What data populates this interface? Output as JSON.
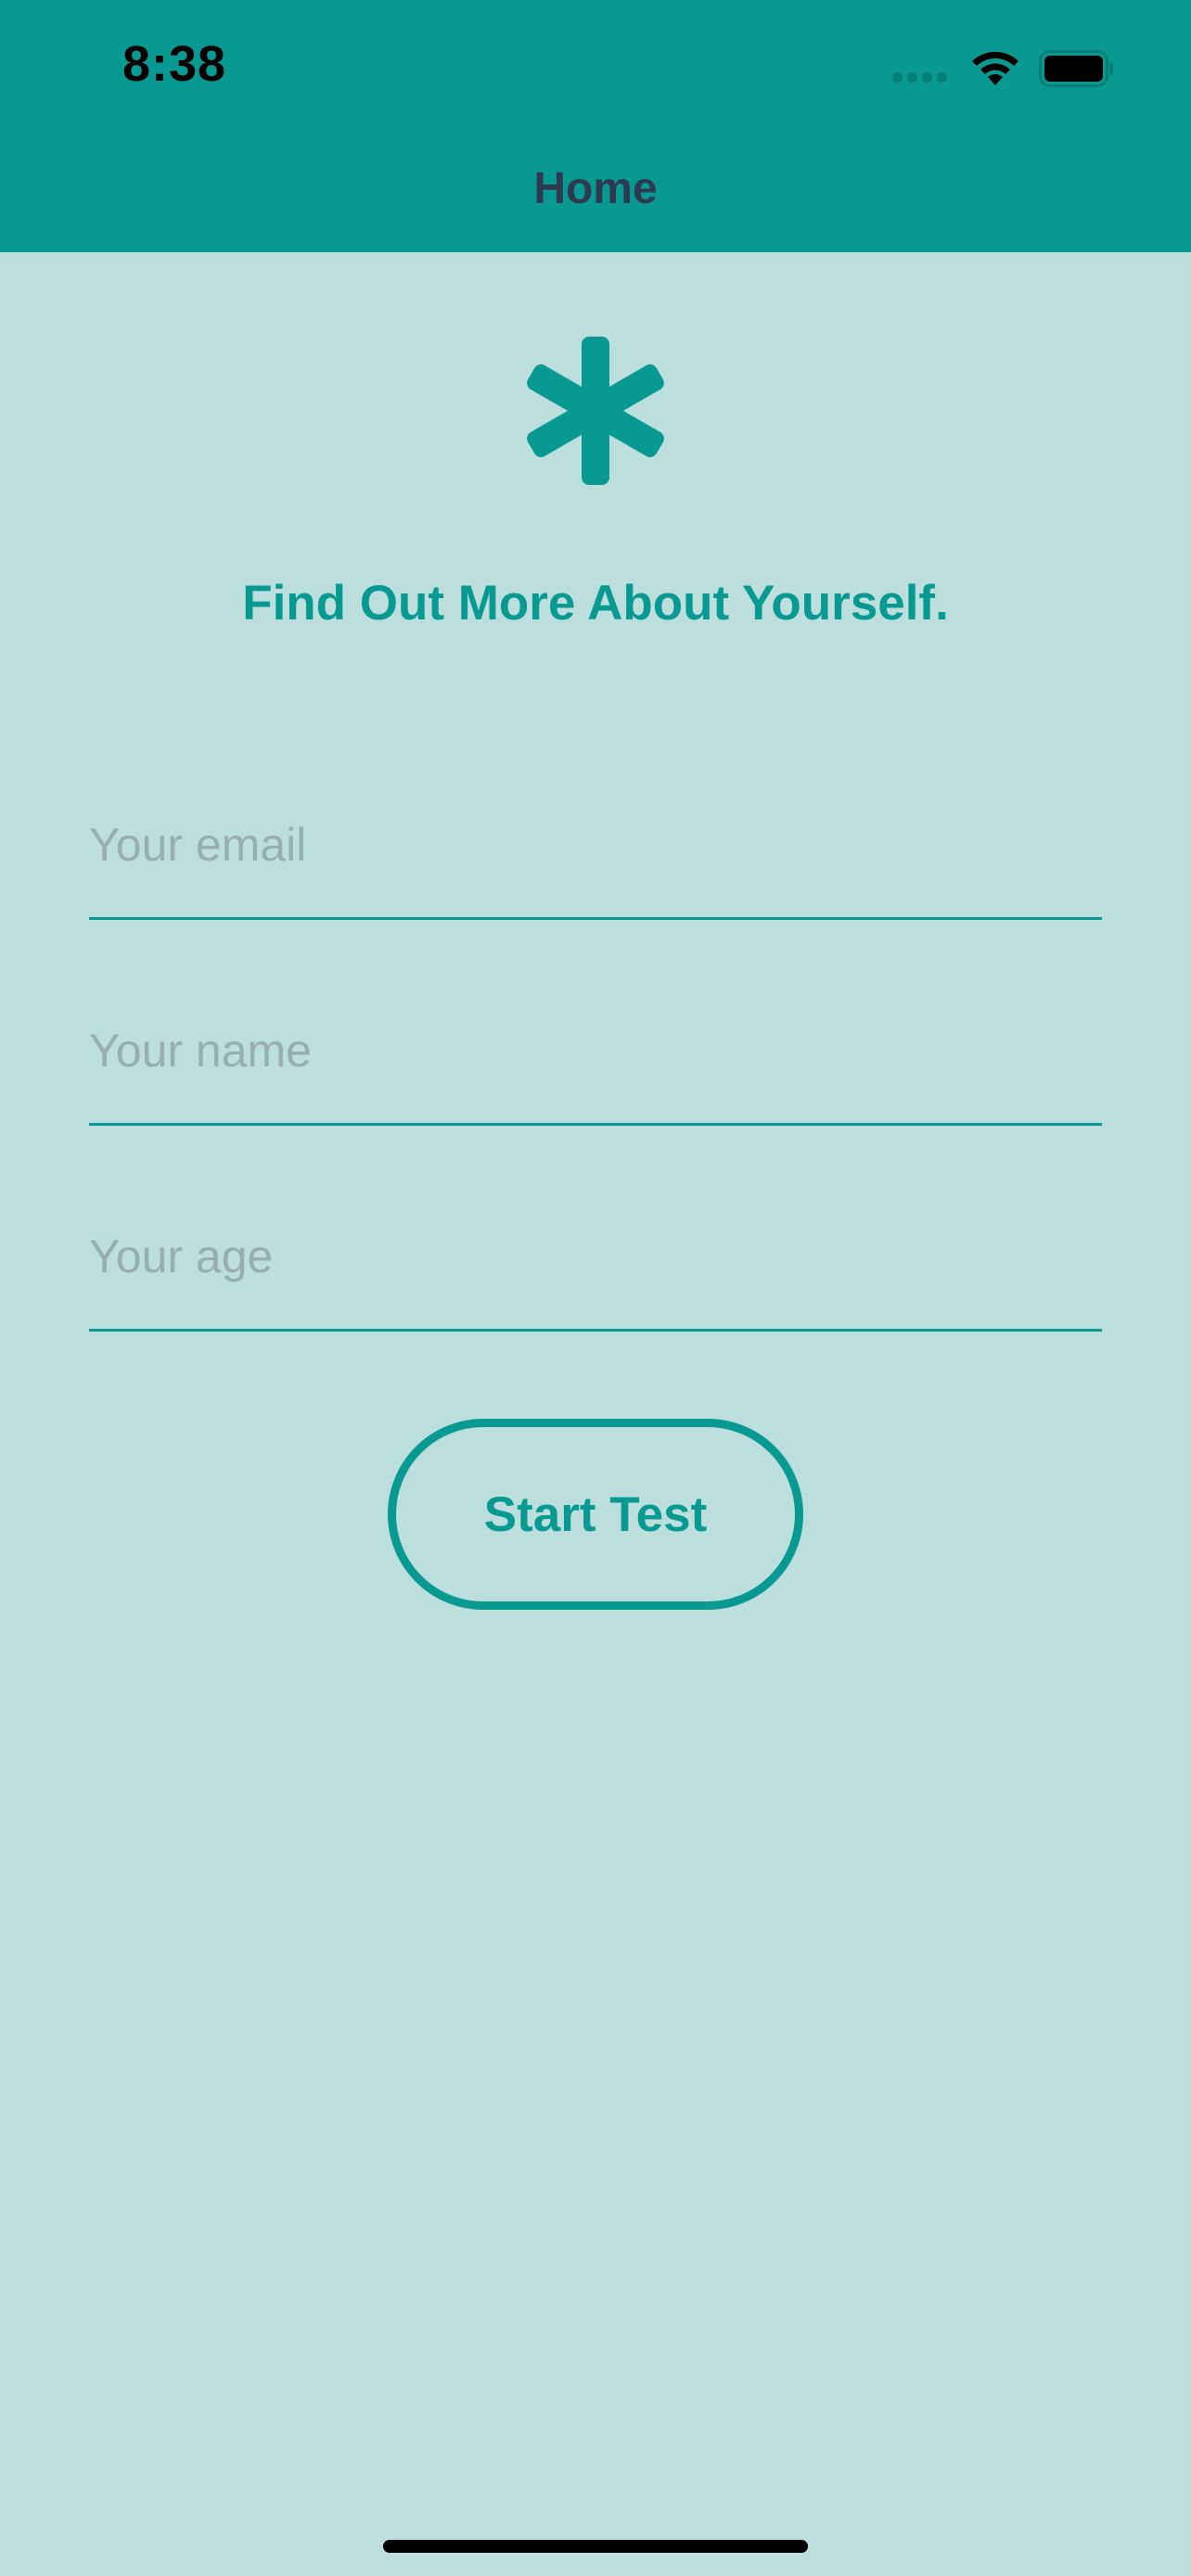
{
  "status_bar": {
    "time": "8:38"
  },
  "nav": {
    "title": "Home"
  },
  "logo": {
    "icon": "asterisk-icon",
    "color": "#089a92"
  },
  "tagline": "Find Out More About Yourself.",
  "form": {
    "email": {
      "value": "",
      "placeholder": "Your email"
    },
    "name": {
      "value": "",
      "placeholder": "Your name"
    },
    "age": {
      "value": "",
      "placeholder": "Your age"
    }
  },
  "actions": {
    "start_label": "Start Test"
  },
  "colors": {
    "header": "#089a92",
    "background": "#bcdfdd",
    "accent": "#089a92",
    "nav_title": "#2e3a4f",
    "placeholder": "#97aeb0"
  }
}
